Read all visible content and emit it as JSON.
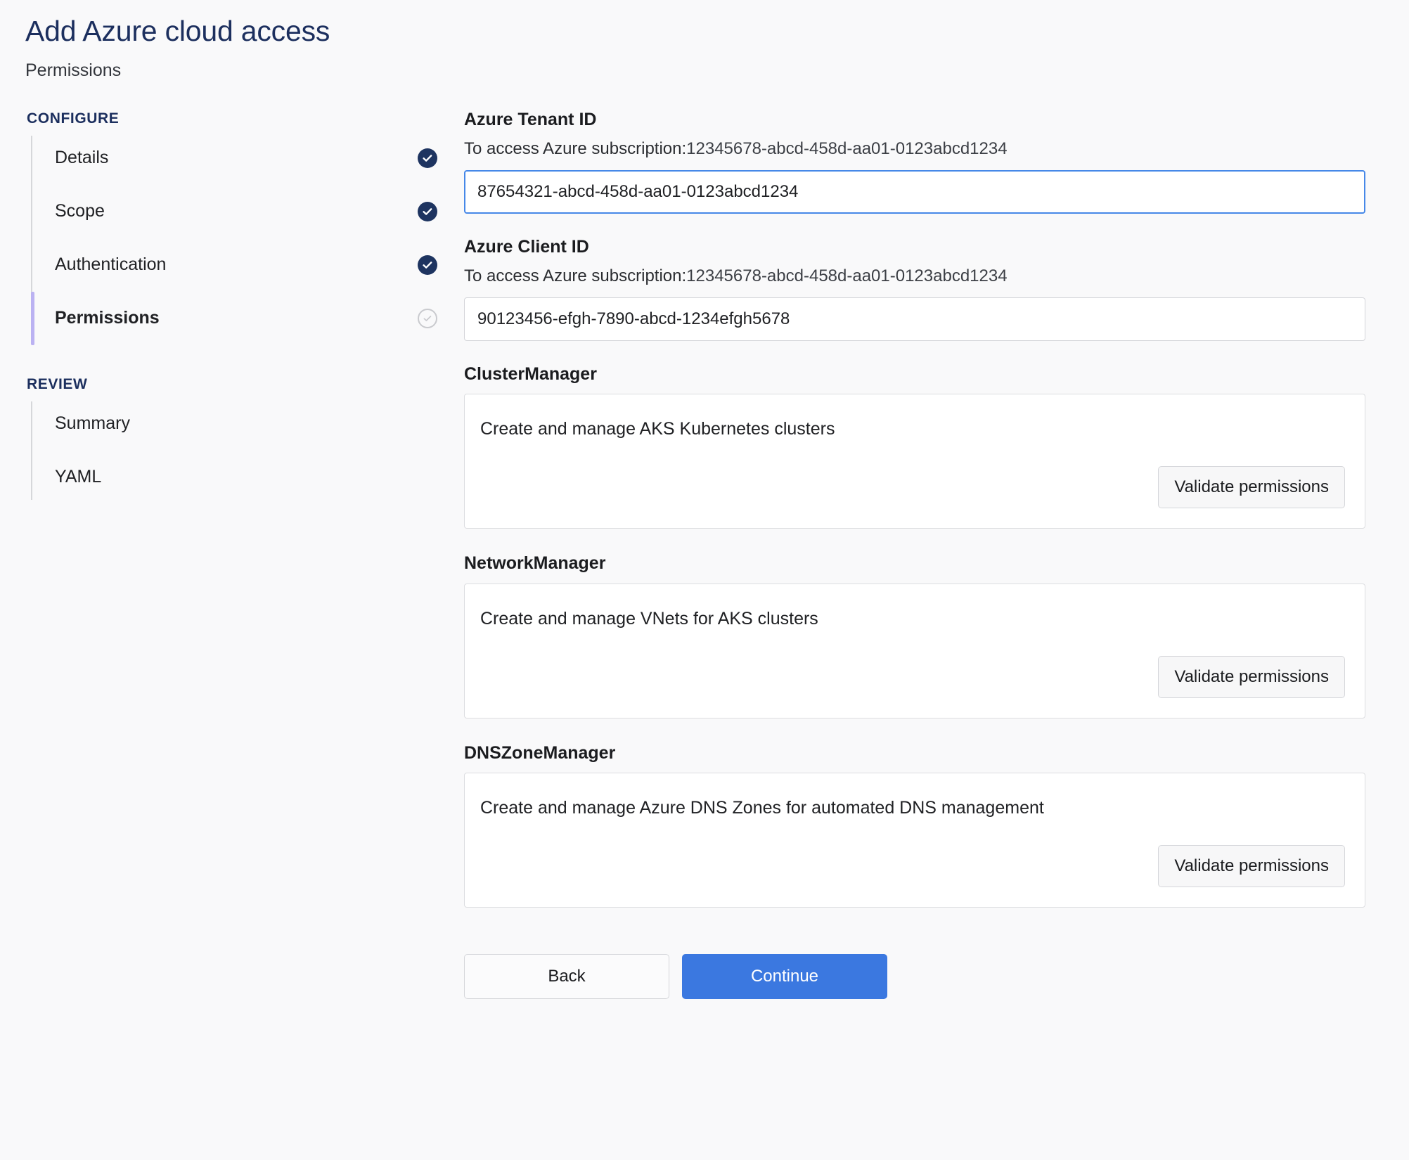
{
  "header": {
    "title": "Add Azure cloud access",
    "subtitle": "Permissions"
  },
  "sidebar": {
    "sections": [
      {
        "title": "CONFIGURE",
        "items": [
          {
            "label": "Details",
            "status": "done",
            "active": false
          },
          {
            "label": "Scope",
            "status": "done",
            "active": false
          },
          {
            "label": "Authentication",
            "status": "done",
            "active": false
          },
          {
            "label": "Permissions",
            "status": "pending",
            "active": true
          }
        ]
      },
      {
        "title": "REVIEW",
        "items": [
          {
            "label": "Summary",
            "status": "none",
            "active": false
          },
          {
            "label": "YAML",
            "status": "none",
            "active": false
          }
        ]
      }
    ]
  },
  "main": {
    "fields": [
      {
        "label": "Azure Tenant ID",
        "hint_prefix": "To access Azure subscription:",
        "hint_value": "12345678-abcd-458d-aa01-0123abcd1234",
        "value": "87654321-abcd-458d-aa01-0123abcd1234",
        "focused": true
      },
      {
        "label": "Azure Client ID",
        "hint_prefix": "To access Azure subscription:",
        "hint_value": "12345678-abcd-458d-aa01-0123abcd1234",
        "value": "90123456-efgh-7890-abcd-1234efgh5678",
        "focused": false
      }
    ],
    "permissions": [
      {
        "title": "ClusterManager",
        "description": "Create and manage AKS Kubernetes clusters",
        "button_label": "Validate permissions"
      },
      {
        "title": "NetworkManager",
        "description": "Create and manage VNets for AKS clusters",
        "button_label": "Validate permissions"
      },
      {
        "title": "DNSZoneManager",
        "description": "Create and manage Azure DNS Zones for automated DNS management",
        "button_label": "Validate permissions"
      }
    ],
    "footer": {
      "back_label": "Back",
      "continue_label": "Continue"
    }
  },
  "colors": {
    "title_navy": "#1c2f5e",
    "step_done": "#1e3460",
    "active_bar": "#bbb2f2",
    "focus_border": "#4688e8",
    "primary_button": "#3b78e0",
    "background": "#f9f9fa"
  }
}
